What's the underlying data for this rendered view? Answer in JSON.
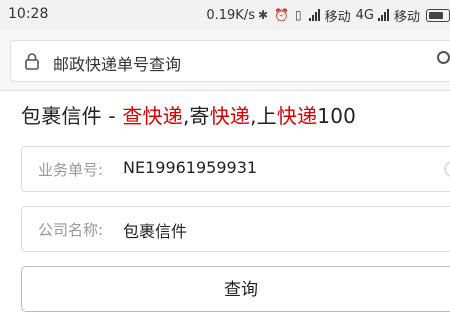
{
  "status_bar": {
    "time": "10:28",
    "net_speed": "0.19K/s",
    "carrier1": "移动",
    "network1": "4G",
    "carrier2": "移动"
  },
  "address_bar": {
    "url_text": "邮政快递单号查询"
  },
  "page": {
    "title_prefix": "包裹信件 - ",
    "title_red1": "查快递",
    "title_sep1": ",寄",
    "title_red2": "快递",
    "title_sep2": ",上",
    "title_red3": "快递",
    "title_suffix": "100",
    "accent_color": "#d40000"
  },
  "form": {
    "tracking_label": "业务单号:",
    "tracking_value": "NE19961959931",
    "company_label": "公司名称:",
    "company_value": "包裹信件",
    "query_button": "查询"
  }
}
